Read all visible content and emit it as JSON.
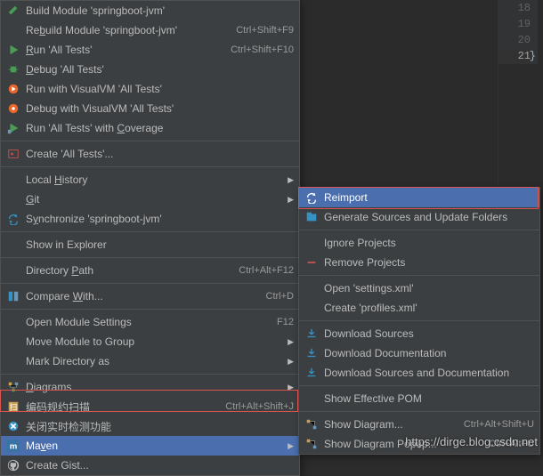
{
  "gutter": {
    "lines": [
      "18",
      "19",
      "20",
      "21"
    ],
    "highlight": 3,
    "brace": "}"
  },
  "menu": [
    {
      "t": "item",
      "icon": "hammer",
      "label": "Build Module 'springboot-jvm'"
    },
    {
      "t": "item",
      "icon": "",
      "label": "Rebuild Module 'springboot-jvm'",
      "shortcut": "Ctrl+Shift+F9",
      "u": 2
    },
    {
      "t": "item",
      "icon": "play",
      "label": "Run 'All Tests'",
      "shortcut": "Ctrl+Shift+F10",
      "u": 0
    },
    {
      "t": "item",
      "icon": "bug",
      "label": "Debug 'All Tests'",
      "u": 0
    },
    {
      "t": "item",
      "icon": "visualvm",
      "label": "Run with VisualVM 'All Tests'"
    },
    {
      "t": "item",
      "icon": "visualvm-d",
      "label": "Debug with VisualVM 'All Tests'"
    },
    {
      "t": "item",
      "icon": "coverage",
      "label": "Run 'All Tests' with Coverage",
      "u": 21
    },
    {
      "t": "sep"
    },
    {
      "t": "item",
      "icon": "create",
      "label": "Create 'All Tests'..."
    },
    {
      "t": "sep"
    },
    {
      "t": "item",
      "icon": "",
      "label": "Local History",
      "arrow": true,
      "u": 6
    },
    {
      "t": "item",
      "icon": "",
      "label": "Git",
      "arrow": true,
      "u": 0
    },
    {
      "t": "item",
      "icon": "sync",
      "label": "Synchronize 'springboot-jvm'",
      "u": 1
    },
    {
      "t": "sep"
    },
    {
      "t": "item",
      "icon": "",
      "label": "Show in Explorer"
    },
    {
      "t": "sep"
    },
    {
      "t": "item",
      "icon": "",
      "label": "Directory Path",
      "shortcut": "Ctrl+Alt+F12",
      "u": 10
    },
    {
      "t": "sep"
    },
    {
      "t": "item",
      "icon": "diff",
      "label": "Compare With...",
      "shortcut": "Ctrl+D",
      "u": 8
    },
    {
      "t": "sep"
    },
    {
      "t": "item",
      "icon": "",
      "label": "Open Module Settings",
      "shortcut": "F12"
    },
    {
      "t": "item",
      "icon": "",
      "label": "Move Module to Group",
      "arrow": true
    },
    {
      "t": "item",
      "icon": "",
      "label": "Mark Directory as",
      "arrow": true
    },
    {
      "t": "sep"
    },
    {
      "t": "item",
      "icon": "diagram",
      "label": "Diagrams",
      "arrow": true,
      "u": 0
    },
    {
      "t": "item",
      "icon": "scan",
      "label": "编码规约扫描",
      "shortcut": "Ctrl+Alt+Shift+J"
    },
    {
      "t": "item",
      "icon": "close-rt",
      "label": "关闭实时检测功能"
    },
    {
      "t": "item",
      "icon": "maven",
      "label": "Maven",
      "arrow": true,
      "sel": true,
      "u": 2
    },
    {
      "t": "item",
      "icon": "github",
      "label": "Create Gist..."
    }
  ],
  "submenu": [
    {
      "t": "item",
      "icon": "reimport",
      "label": "Reimport",
      "sel": true
    },
    {
      "t": "item",
      "icon": "gen",
      "label": "Generate Sources and Update Folders"
    },
    {
      "t": "sep"
    },
    {
      "t": "item",
      "icon": "",
      "label": "Ignore Projects"
    },
    {
      "t": "item",
      "icon": "minus",
      "label": "Remove Projects"
    },
    {
      "t": "sep"
    },
    {
      "t": "item",
      "icon": "",
      "label": "Open 'settings.xml'"
    },
    {
      "t": "item",
      "icon": "",
      "label": "Create 'profiles.xml'"
    },
    {
      "t": "sep"
    },
    {
      "t": "item",
      "icon": "dl",
      "label": "Download Sources"
    },
    {
      "t": "item",
      "icon": "dl",
      "label": "Download Documentation"
    },
    {
      "t": "item",
      "icon": "dl",
      "label": "Download Sources and Documentation"
    },
    {
      "t": "sep"
    },
    {
      "t": "item",
      "icon": "",
      "label": "Show Effective POM"
    },
    {
      "t": "sep"
    },
    {
      "t": "item",
      "icon": "diag2",
      "label": "Show Diagram...",
      "shortcut": "Ctrl+Alt+Shift+U"
    },
    {
      "t": "item",
      "icon": "diag2",
      "label": "Show Diagram Popup...",
      "shortcut": "Ctrl+Alt+U"
    }
  ],
  "watermark": "https://dirge.blog.csdn.net"
}
